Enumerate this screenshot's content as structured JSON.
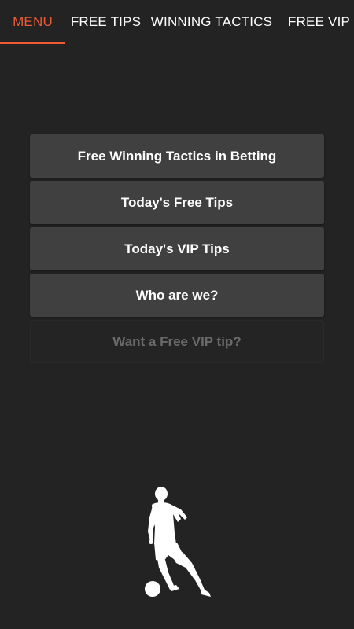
{
  "tabs": [
    {
      "label": "MENU",
      "active": true
    },
    {
      "label": "FREE TIPS",
      "active": false
    },
    {
      "label": "WINNING TACTICS",
      "active": false
    },
    {
      "label": "FREE VIP GI",
      "active": false
    }
  ],
  "accent_color": "#ee5a33",
  "menu": {
    "buttons": [
      {
        "label": "Free Winning Tactics in Betting",
        "enabled": true
      },
      {
        "label": "Today's Free Tips",
        "enabled": true
      },
      {
        "label": "Today's VIP Tips",
        "enabled": true
      },
      {
        "label": "Who are we?",
        "enabled": true
      },
      {
        "label": "Want a Free VIP tip?",
        "enabled": false
      }
    ]
  },
  "illustration": {
    "icon": "soccer-player-icon"
  }
}
